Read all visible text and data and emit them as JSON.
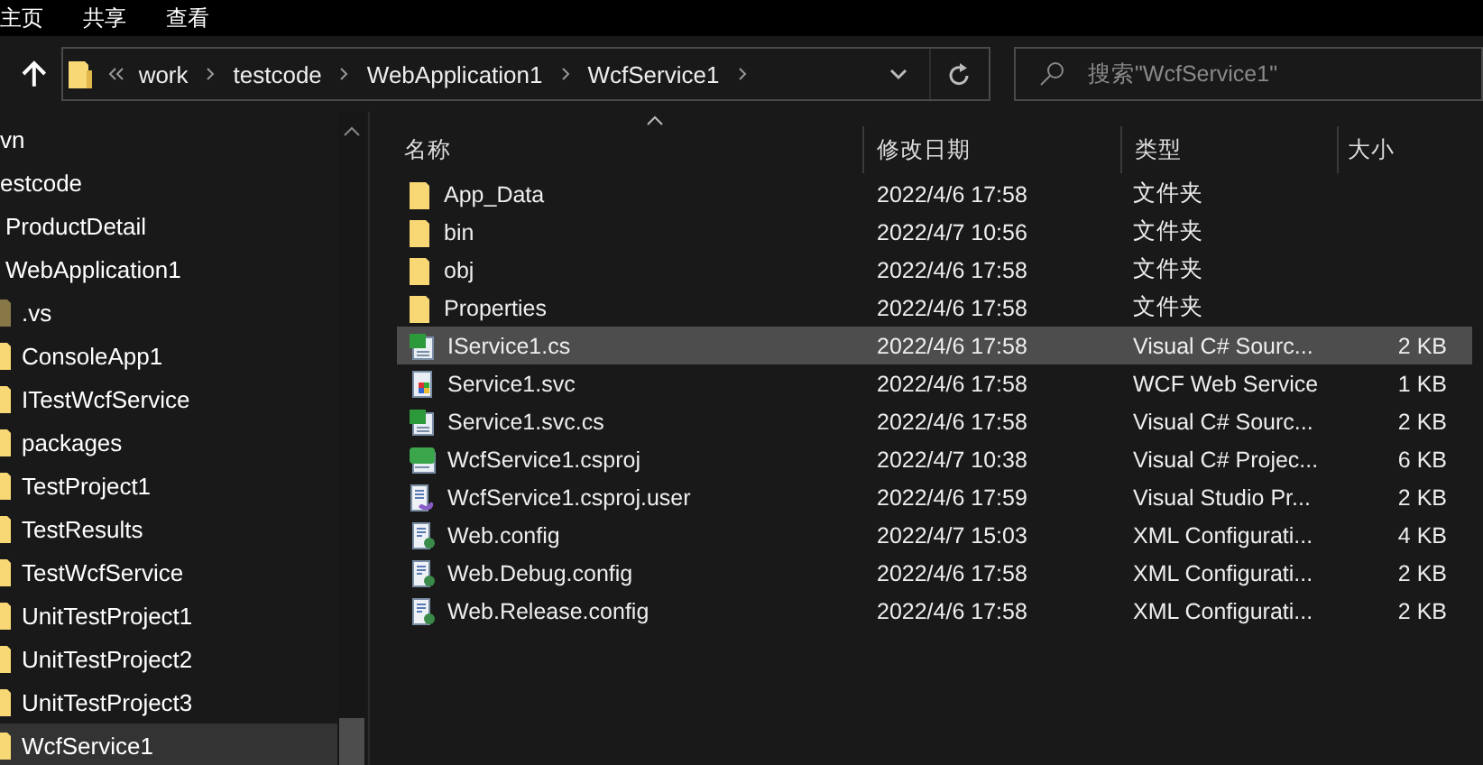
{
  "ribbon": {
    "tabs": [
      "主页",
      "共享",
      "查看"
    ]
  },
  "address_bar": {
    "path": [
      "work",
      "testcode",
      "WebApplication1",
      "WcfService1"
    ]
  },
  "search": {
    "placeholder": "搜索\"WcfService1\""
  },
  "sidebar": {
    "items": [
      {
        "label": "vn",
        "selected": false
      },
      {
        "label": "estcode",
        "selected": false,
        "children": [
          {
            "label": "ProductDetail",
            "selected": false
          },
          {
            "label": "WebApplication1",
            "selected": false,
            "children": [
              {
                "label": ".vs",
                "selected": false,
                "hidden": true
              },
              {
                "label": "ConsoleApp1",
                "selected": false,
                "hidden": false
              },
              {
                "label": "ITestWcfService",
                "selected": false,
                "hidden": false
              },
              {
                "label": "packages",
                "selected": false,
                "hidden": false
              },
              {
                "label": "TestProject1",
                "selected": false,
                "hidden": false
              },
              {
                "label": "TestResults",
                "selected": false,
                "hidden": false
              },
              {
                "label": "TestWcfService",
                "selected": false,
                "hidden": false
              },
              {
                "label": "UnitTestProject1",
                "selected": false,
                "hidden": false
              },
              {
                "label": "UnitTestProject2",
                "selected": false,
                "hidden": false
              },
              {
                "label": "UnitTestProject3",
                "selected": false,
                "hidden": false
              },
              {
                "label": "WcfService1",
                "selected": true,
                "hidden": false
              }
            ]
          }
        ]
      }
    ]
  },
  "table": {
    "columns": [
      "名称",
      "修改日期",
      "类型",
      "大小"
    ],
    "rows": [
      {
        "kind": "folder",
        "name": "App_Data",
        "modified": "2022/4/6 17:58",
        "type": "文件夹",
        "selected": false
      },
      {
        "kind": "folder",
        "name": "bin",
        "modified": "2022/4/7 10:56",
        "type": "文件夹",
        "selected": false
      },
      {
        "kind": "folder",
        "name": "obj",
        "modified": "2022/4/6 17:58",
        "type": "文件夹",
        "selected": false
      },
      {
        "kind": "folder",
        "name": "Properties",
        "modified": "2022/4/6 17:58",
        "type": "文件夹",
        "selected": false
      },
      {
        "kind": "cs",
        "name": "IService1.cs",
        "modified": "2022/4/6 17:58",
        "type": "Visual C# Sourc...",
        "size": "2 KB",
        "selected": true
      },
      {
        "kind": "svc",
        "name": "Service1.svc",
        "modified": "2022/4/6 17:58",
        "type": "WCF Web Service",
        "size": "1 KB",
        "selected": false
      },
      {
        "kind": "cs",
        "name": "Service1.svc.cs",
        "modified": "2022/4/6 17:58",
        "type": "Visual C# Sourc...",
        "size": "2 KB",
        "selected": false
      },
      {
        "kind": "csproj",
        "name": "WcfService1.csproj",
        "modified": "2022/4/7 10:38",
        "type": "Visual C# Projec...",
        "size": "6 KB",
        "selected": false
      },
      {
        "kind": "user",
        "name": "WcfService1.csproj.user",
        "modified": "2022/4/6 17:59",
        "type": "Visual Studio Pr...",
        "size": "2 KB",
        "selected": false
      },
      {
        "kind": "config",
        "name": "Web.config",
        "modified": "2022/4/7 15:03",
        "type": "XML Configurati...",
        "size": "4 KB",
        "selected": false
      },
      {
        "kind": "config",
        "name": "Web.Debug.config",
        "modified": "2022/4/6 17:58",
        "type": "XML Configurati...",
        "size": "2 KB",
        "selected": false
      },
      {
        "kind": "config",
        "name": "Web.Release.config",
        "modified": "2022/4/6 17:58",
        "type": "XML Configurati...",
        "size": "2 KB",
        "selected": false
      }
    ]
  }
}
